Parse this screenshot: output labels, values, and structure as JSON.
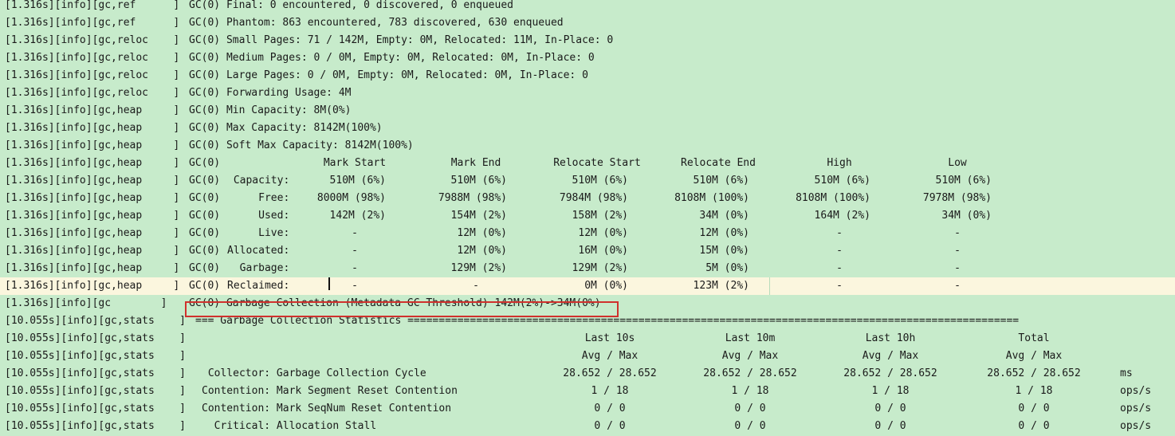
{
  "colors": {
    "background": "#c7ebcb",
    "highlight_line": "#fbf6de",
    "annotation_box": "#d0312d",
    "text": "#1a1a1a"
  },
  "log": {
    "lines": [
      {
        "tag": "[1.316s][info][gc,ref      ]",
        "msg": "GC(0) Final: 0 encountered, 0 discovered, 0 enqueued"
      },
      {
        "tag": "[1.316s][info][gc,ref      ]",
        "msg": "GC(0) Phantom: 863 encountered, 783 discovered, 630 enqueued"
      },
      {
        "tag": "[1.316s][info][gc,reloc    ]",
        "msg": "GC(0) Small Pages: 71 / 142M, Empty: 0M, Relocated: 11M, In-Place: 0"
      },
      {
        "tag": "[1.316s][info][gc,reloc    ]",
        "msg": "GC(0) Medium Pages: 0 / 0M, Empty: 0M, Relocated: 0M, In-Place: 0"
      },
      {
        "tag": "[1.316s][info][gc,reloc    ]",
        "msg": "GC(0) Large Pages: 0 / 0M, Empty: 0M, Relocated: 0M, In-Place: 0"
      },
      {
        "tag": "[1.316s][info][gc,reloc    ]",
        "msg": "GC(0) Forwarding Usage: 4M"
      },
      {
        "tag": "[1.316s][info][gc,heap     ]",
        "msg": "GC(0) Min Capacity: 8M(0%)"
      },
      {
        "tag": "[1.316s][info][gc,heap     ]",
        "msg": "GC(0) Max Capacity: 8142M(100%)"
      },
      {
        "tag": "[1.316s][info][gc,heap     ]",
        "msg": "GC(0) Soft Max Capacity: 8142M(100%)"
      }
    ],
    "heap_table": {
      "tag": "[1.316s][info][gc,heap     ]",
      "prefix": "GC(0)",
      "headers": [
        "Mark Start",
        "Mark End",
        "Relocate Start",
        "Relocate End",
        "High",
        "Low"
      ],
      "rows": [
        {
          "label": " Capacity:",
          "cells": [
            "510M (6%)",
            "510M (6%)",
            "510M (6%)",
            "510M (6%)",
            "510M (6%)",
            "510M (6%)"
          ]
        },
        {
          "label": "     Free:",
          "cells": [
            "8000M (98%)",
            "7988M (98%)",
            "7984M (98%)",
            "8108M (100%)",
            "8108M (100%)",
            "7978M (98%)"
          ]
        },
        {
          "label": "     Used:",
          "cells": [
            "142M (2%)",
            "154M (2%)",
            "158M (2%)",
            "34M (0%)",
            "164M (2%)",
            "34M (0%)"
          ]
        },
        {
          "label": "     Live:",
          "cells": [
            "-",
            "12M (0%)",
            "12M (0%)",
            "12M (0%)",
            "-",
            "-"
          ]
        },
        {
          "label": "Allocated:",
          "cells": [
            "-",
            "12M (0%)",
            "16M (0%)",
            "15M (0%)",
            "-",
            "-"
          ]
        },
        {
          "label": "  Garbage:",
          "cells": [
            "-",
            "129M (2%)",
            "129M (2%)",
            "5M (0%)",
            "-",
            "-"
          ]
        },
        {
          "label": "Reclaimed:",
          "cells": [
            "-",
            "-",
            "0M (0%)",
            "123M (2%)",
            "-",
            "-"
          ]
        }
      ]
    },
    "gc_summary": {
      "tag": "[1.316s][info][gc        ]",
      "msg": "GC(0) Garbage Collection (Metadata GC Threshold) 142M(2%)->34M(0%)"
    },
    "stats": {
      "tag": "[10.055s][info][gc,stats    ]",
      "banner": "=== Garbage Collection Statistics ==================================================================================================",
      "headers": [
        "Last 10s",
        "Last 10m",
        "Last 10h",
        "Total"
      ],
      "subheaders": [
        "Avg / Max",
        "Avg / Max",
        "Avg / Max",
        "Avg / Max"
      ],
      "rows": [
        {
          "label": " Collector: Garbage Collection Cycle",
          "cells": [
            "28.652 / 28.652",
            "28.652 / 28.652",
            "28.652 / 28.652",
            "28.652 / 28.652"
          ],
          "unit": "ms"
        },
        {
          "label": "Contention: Mark Segment Reset Contention",
          "cells": [
            "1 / 18",
            "1 / 18",
            "1 / 18",
            "1 / 18"
          ],
          "unit": "ops/s"
        },
        {
          "label": "Contention: Mark SeqNum Reset Contention",
          "cells": [
            "0 / 0",
            "0 / 0",
            "0 / 0",
            "0 / 0"
          ],
          "unit": "ops/s"
        },
        {
          "label": "  Critical: Allocation Stall",
          "cells": [
            "0 / 0",
            "0 / 0",
            "0 / 0",
            "0 / 0"
          ],
          "unit": "ops/s"
        }
      ]
    }
  }
}
